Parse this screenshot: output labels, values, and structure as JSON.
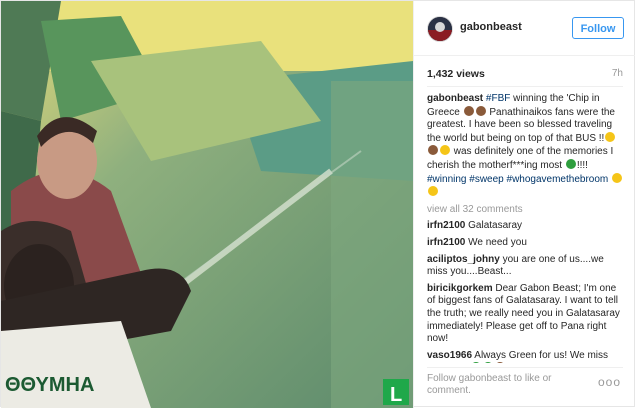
{
  "post": {
    "author": "gabonbeast",
    "follow_label": "Follow",
    "views": "1,432 views",
    "age": "7h",
    "media": {
      "watermark": "L",
      "jersey_text": "ΘΘΥΜΗΑ"
    },
    "caption": {
      "user": "gabonbeast",
      "tag1": "#FBF",
      "part1": " winning the 'Chip in Greece ",
      "part2": " Panathinaikos fans were the greatest. I have been so blessed traveling the world but being on top of that BUS !!",
      "part3": " was definitely one of the memories I cherish the motherf***ing most ",
      "part4": "!!!! ",
      "tag2": "#winning",
      "tag3": "#sweep",
      "tag4": "#whogavemethebroom"
    },
    "view_all": "view all 32 comments",
    "comments": [
      {
        "user": "irfn2100",
        "text": "Galatasaray"
      },
      {
        "user": "irfn2100",
        "text": "We need you"
      },
      {
        "user": "aciliptos_johny",
        "text": "you are one of us....we miss you....Beast..."
      },
      {
        "user": "biricikgorkem",
        "text": "Dear Gabon Beast; I'm one of biggest fans of Galatasaray. I want to tell the truth; we really need you in Galatasaray immediately! Please get off to Pana right now!"
      },
      {
        "user": "vaso1966",
        "text": "Always Green for us! We miss you a lot!"
      }
    ],
    "footer_text": "Follow gabonbeast to like or comment.",
    "more_label": "ooo"
  }
}
